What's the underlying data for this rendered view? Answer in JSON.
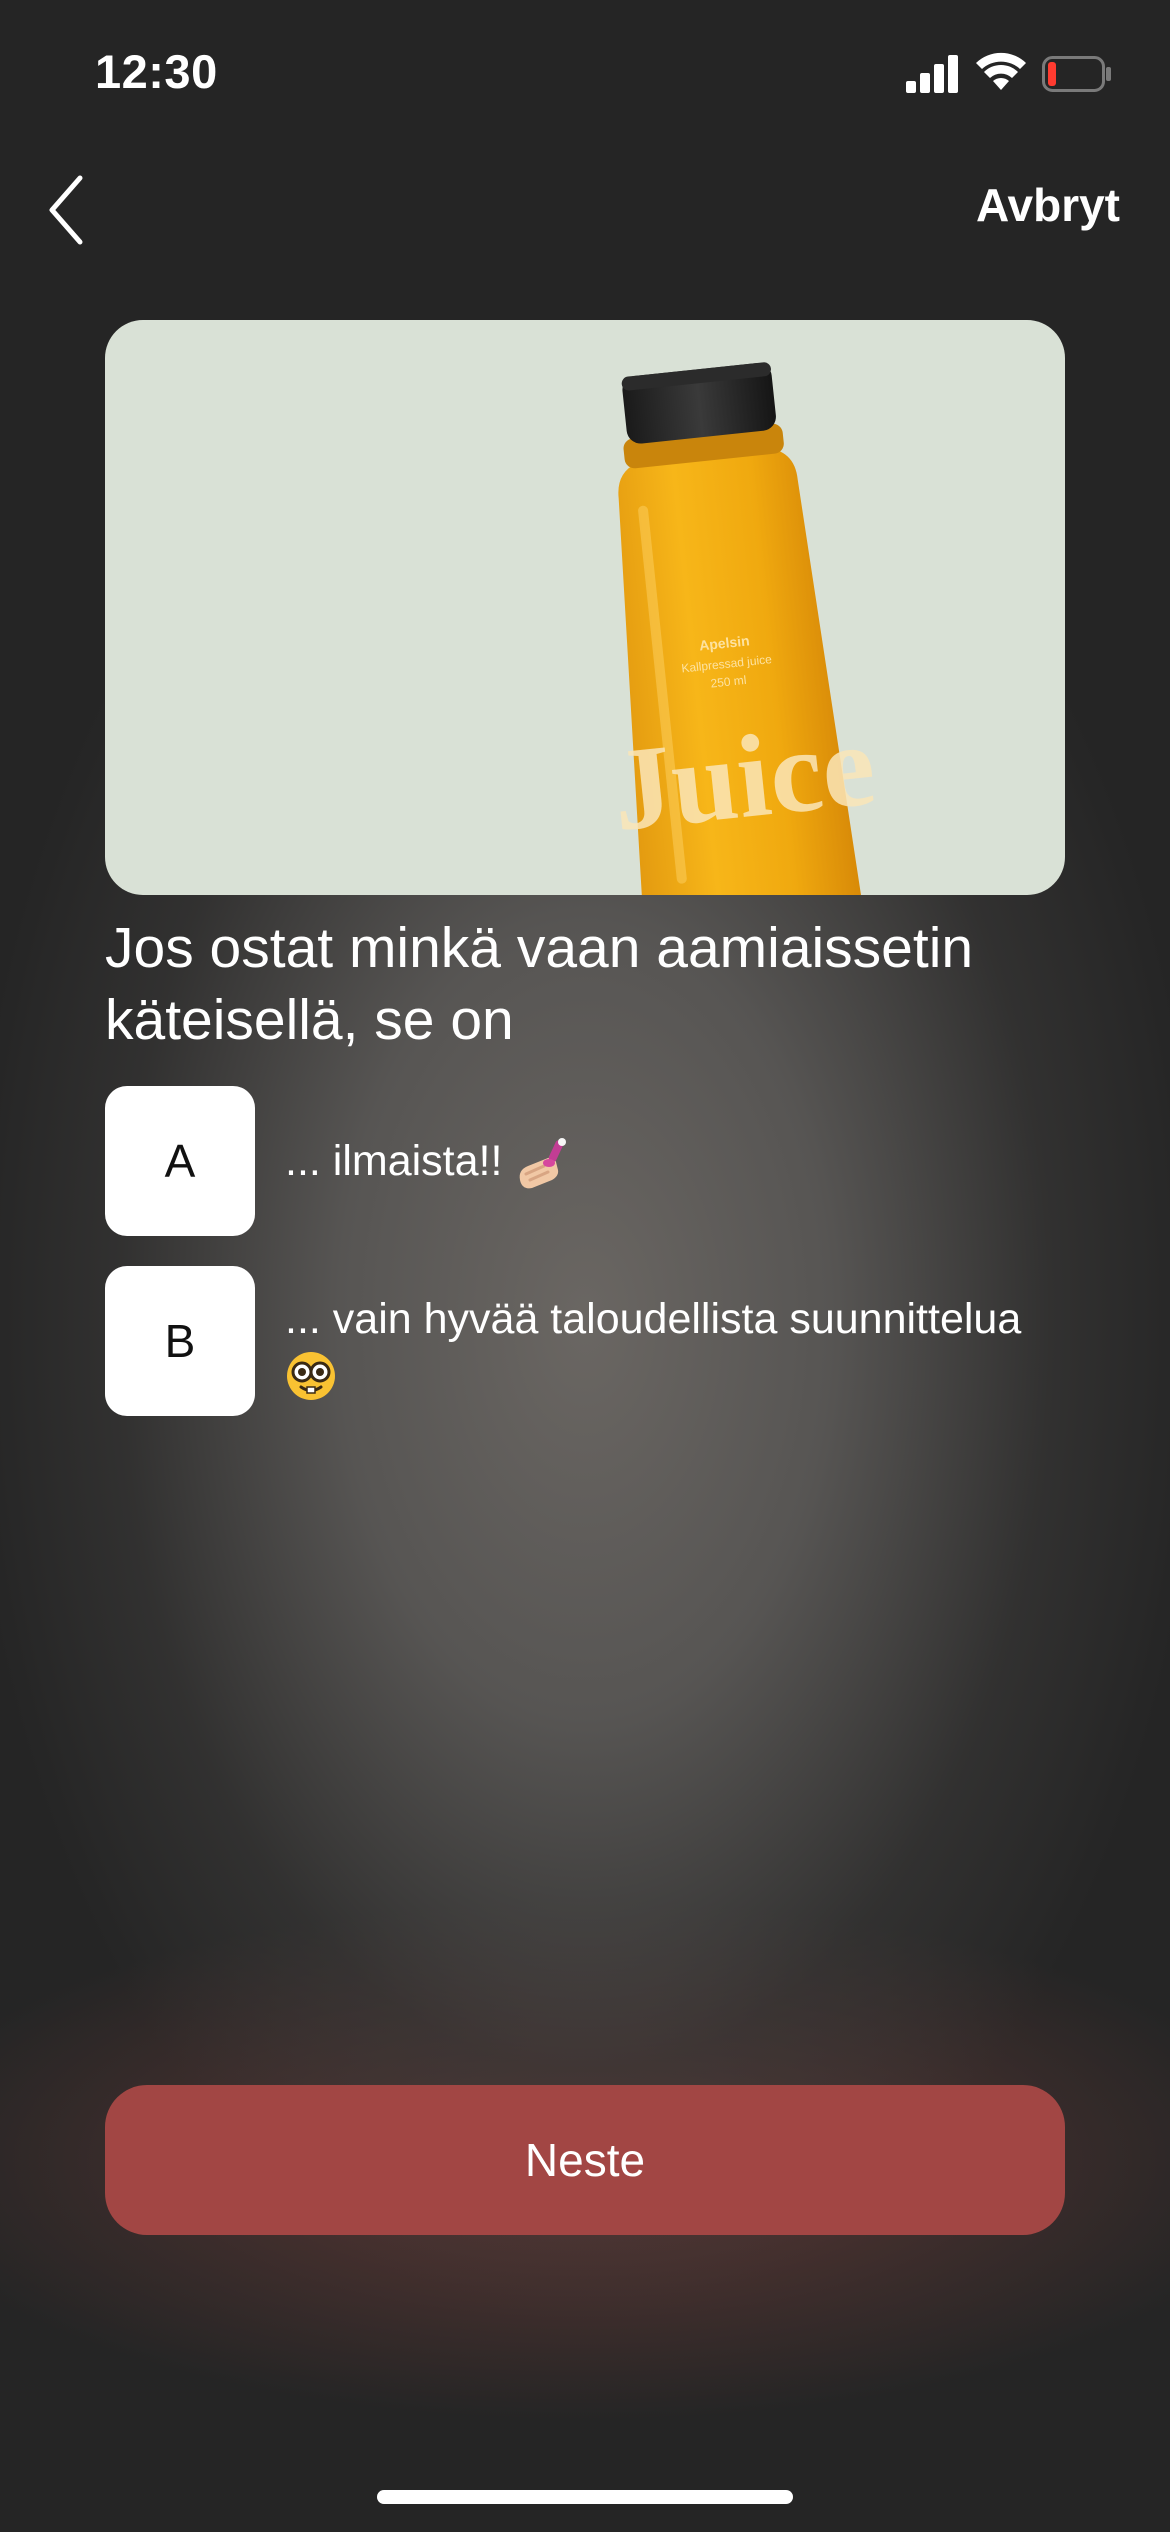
{
  "status_bar": {
    "time": "12:30",
    "signal_icon": "cellular-signal-icon",
    "wifi_icon": "wifi-icon",
    "battery_icon": "battery-low-icon",
    "battery_level": 0.12,
    "battery_color": "#ff3b30"
  },
  "nav": {
    "back_icon": "chevron-left-icon",
    "cancel_label": "Avbryt"
  },
  "hero": {
    "background_color": "#d9e1d6",
    "bottle": {
      "flavor": "Apelsin",
      "subtitle": "Kallpressad juice",
      "volume": "250 ml",
      "brand": "Juice"
    }
  },
  "question": "Jos ostat minkä vaan aamiaissetin käteisellä, se on",
  "options": [
    {
      "letter": "A",
      "text": "... ilmaista!!",
      "emoji_icon": "nail-polish-emoji"
    },
    {
      "letter": "B",
      "text": "... vain hyvää taloudellista suunnittelua",
      "emoji_icon": "nerd-face-emoji"
    }
  ],
  "next_button": {
    "label": "Neste",
    "color": "#a24644"
  }
}
